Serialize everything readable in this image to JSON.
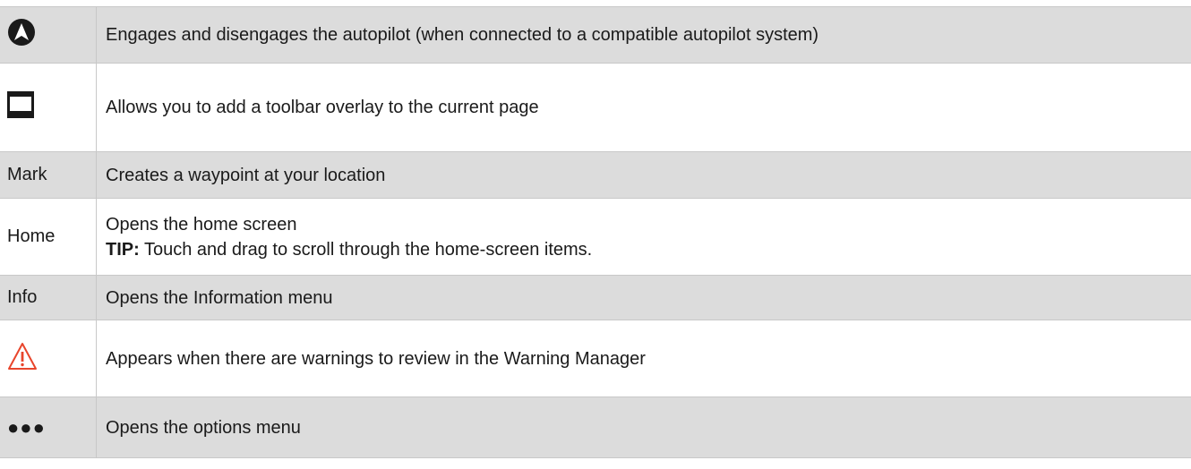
{
  "rows": [
    {
      "key_icon": "autopilot-arrow-icon",
      "description": "Engages and disengages the autopilot (when connected to a compatible autopilot system)"
    },
    {
      "key_icon": "toolbar-overlay-icon",
      "description": "Allows you to add a toolbar overlay to the current page"
    },
    {
      "key": "Mark",
      "description": "Creates a waypoint at your location"
    },
    {
      "key": "Home",
      "description": "Opens the home screen",
      "tip_label": "TIP:",
      "tip_text": " Touch and drag to scroll through the home-screen items."
    },
    {
      "key": "Info",
      "description": "Opens the Information menu"
    },
    {
      "key_icon": "warning-triangle-icon",
      "description": "Appears when there are warnings to review in the Warning Manager"
    },
    {
      "key_icon": "more-options-dots-icon",
      "key_glyph": "●●●",
      "description": "Opens the options menu"
    }
  ],
  "colors": {
    "shaded_row": "#dcdcdc",
    "border": "#c8c8c8",
    "warning_red": "#e8452c",
    "icon_dark": "#1a1a1a"
  }
}
